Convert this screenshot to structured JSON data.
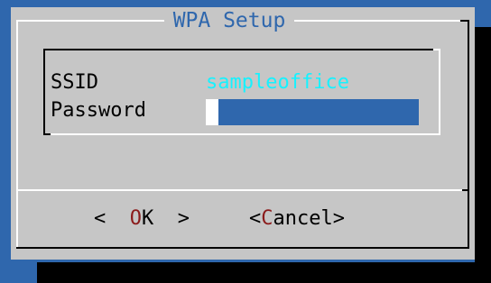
{
  "dialog": {
    "title": "WPA Setup",
    "fields": {
      "ssid_label": "SSID",
      "ssid_value": "sampleoffice",
      "password_label": "Password",
      "password_value": ""
    },
    "buttons": {
      "ok_open": "<  ",
      "ok_hotkey": "O",
      "ok_rest": "K  >",
      "cancel_open": "<",
      "cancel_hotkey": "C",
      "cancel_rest": "ancel>"
    }
  },
  "colors": {
    "background": "#2f67ad",
    "dialog": "#c6c6c6",
    "title": "#2f67ad",
    "ssid_value": "#16f2ff",
    "hotkey": "#8b1b1b"
  }
}
